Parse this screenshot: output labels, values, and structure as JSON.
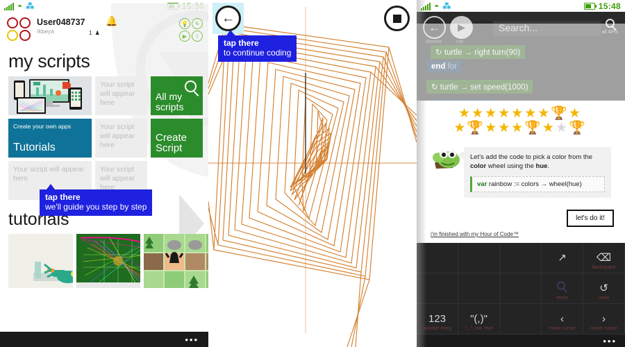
{
  "panel1": {
    "status": {
      "time": "15:30",
      "signal_icon": "signal-bars-icon",
      "wifi_icon": "wifi-icon",
      "bt_icon": "bluetooth-icon",
      "battery_icon": "battery-icon"
    },
    "user": {
      "name": "User048737",
      "handle": "/kbeya",
      "notification_count": "1"
    },
    "page_title": "my scripts",
    "tiles": [
      {
        "id": "hero",
        "kind": "image",
        "label": ""
      },
      {
        "id": "ghost1",
        "kind": "ghost",
        "label": "Your script will appear here"
      },
      {
        "id": "all-my-scripts",
        "kind": "green",
        "label": "All my scripts",
        "icon": "search-icon"
      },
      {
        "id": "tutorials",
        "kind": "blue",
        "small_label": "Create your own apps",
        "label": "Tutorials"
      },
      {
        "id": "ghost2",
        "kind": "ghost",
        "label": "Your script will appear here"
      },
      {
        "id": "create-script",
        "kind": "green",
        "label": "Create Script"
      },
      {
        "id": "ghost3",
        "kind": "ghost",
        "label": "Your script will appear here"
      },
      {
        "id": "ghost4",
        "kind": "ghost",
        "label": "Your script will appear here"
      }
    ],
    "callout": {
      "line1": "tap there",
      "line2": "we'll guide you step by step"
    },
    "section_title": "tutorials",
    "quad_icons": [
      "lightbulb-icon",
      "pencil-icon",
      "play-icon",
      "info-icon"
    ],
    "navbar_more": "•••"
  },
  "panel2": {
    "back_button": "back-icon",
    "stop_button": "stop-icon",
    "callout": {
      "line1": "tap there",
      "line2": "to continue coding"
    },
    "canvas": {
      "turtle": "turtle-sprite",
      "line_color": "#d4802f",
      "shape": "rotating nested squares spiral"
    }
  },
  "panel3": {
    "status": {
      "time": "15:48"
    },
    "toolbar": {
      "dismiss_label": "dismiss",
      "run_label": "run",
      "search_placeholder": "Search...",
      "all_apis_label": "all APIs"
    },
    "code_lines": [
      {
        "text": "↻ turtle → right turn(90)",
        "kind": "green"
      },
      {
        "text": "end for",
        "kind": "blue",
        "keyword": "end",
        "rest": " for"
      },
      {
        "text": "↻ turtle → set speed(1000)",
        "kind": "green"
      }
    ],
    "stars": {
      "row1": [
        "star-gold",
        "star-gold",
        "star-gold",
        "star-gold",
        "star-gold",
        "star-gold",
        "star-gold",
        "trophy-purple",
        "star-gold"
      ],
      "row2": [
        "star-gold",
        "trophy-purple",
        "star-gold",
        "star-gold",
        "star-gold",
        "trophy-purple",
        "star-gold",
        "star-gray",
        "trophy-gray"
      ],
      "gold": "#f2b705",
      "purple": "#7b2fbe",
      "gray": "#d8d8d8"
    },
    "tip": {
      "text_a": "Let's add the code to pick a color from the ",
      "bold_b": "color",
      "text_c": " wheel using the ",
      "bold_d": "hue",
      "text_e": ".",
      "code_keyword": "var",
      "code_rest": " rainbow := colors → wheel(hue)",
      "avatar": "turtle-avatar-icon"
    },
    "primary_button": "let's do it!",
    "finish_link": "i'm finished with my Hour of Code™",
    "keyboard": {
      "keys": [
        {
          "glyph": "",
          "label": ""
        },
        {
          "glyph": "",
          "label": ""
        },
        {
          "glyph": "",
          "label": ""
        },
        {
          "glyph": "↗",
          "label": ""
        },
        {
          "glyph": "⌫",
          "label": "backspace"
        },
        {
          "glyph": "",
          "label": ""
        },
        {
          "glyph": "",
          "label": ""
        },
        {
          "glyph": "",
          "label": ""
        },
        {
          "glyph": "search-icon",
          "label": "more"
        },
        {
          "glyph": "↺",
          "label": "undo"
        },
        {
          "glyph": "123",
          "label": "number entry"
        },
        {
          "glyph": "\"(,)\"",
          "label": "\"...\", not, true"
        },
        {
          "glyph": "",
          "label": ""
        },
        {
          "glyph": "‹",
          "label": "move cursor"
        },
        {
          "glyph": "›",
          "label": "move cursor"
        }
      ],
      "navbar_more": "•••"
    }
  }
}
